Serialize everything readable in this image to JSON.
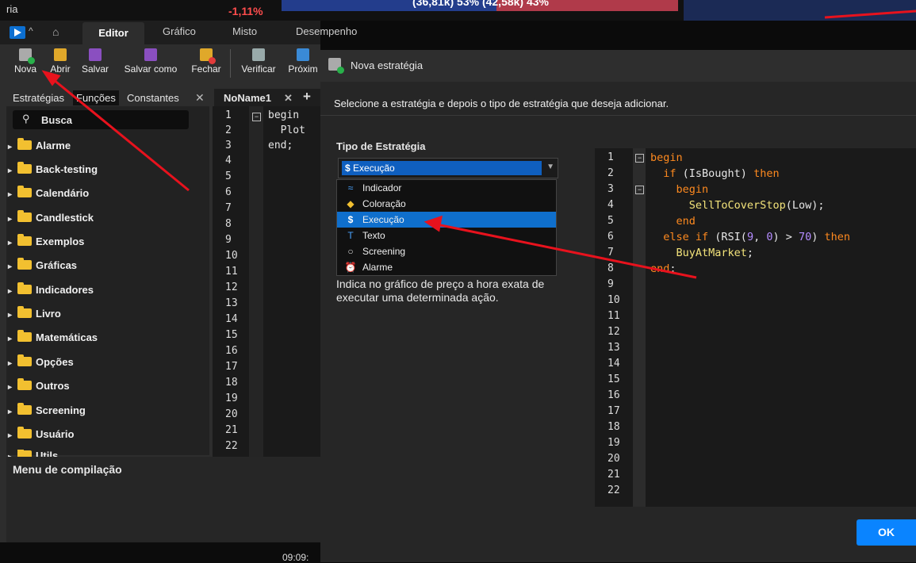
{
  "background": {
    "top_left_label": "ria",
    "change": "-1,11%",
    "bar_text": "(36,81k) 53%   (42,58k) 43%",
    "bottom_time": "09:09:"
  },
  "editor": {
    "window_tabs": [
      "Editor",
      "Gráfico",
      "Misto",
      "Desempenho"
    ],
    "toolbar": [
      "Nova",
      "Abrir",
      "Salvar",
      "Salvar como",
      "Fechar",
      "Verificar",
      "Próxim"
    ],
    "panel_tabs": [
      "Estratégias",
      "Funções",
      "Constantes"
    ],
    "search_placeholder": "Busca",
    "tree": [
      "Alarme",
      "Back-testing",
      "Calendário",
      "Candlestick",
      "Exemplos",
      "Gráficas",
      "Indicadores",
      "Livro",
      "Matemáticas",
      "Opções",
      "Outros",
      "Screening",
      "Usuário",
      "Utils"
    ],
    "code_tab": "NoName1",
    "code_lines": [
      "begin",
      "  Plot",
      "end;"
    ],
    "compile_title": "Menu de compilação"
  },
  "dialog": {
    "title": "Nova estratégia",
    "subtitle": "Selecione a estratégia e depois o tipo de estratégia que deseja adicionar.",
    "type_label": "Tipo de Estratégia",
    "selected": "Execução",
    "options": [
      "Indicador",
      "Coloração",
      "Execução",
      "Texto",
      "Screening",
      "Alarme"
    ],
    "description": "Indica no gráfico de preço a hora exata de executar uma determinada ação.",
    "ok": "OK"
  },
  "colors": {
    "accent": "#0a84ff",
    "keyword": "#ff8a1f",
    "function": "#f3e37a",
    "number": "#b48cff",
    "arrow": "#e8121d"
  }
}
